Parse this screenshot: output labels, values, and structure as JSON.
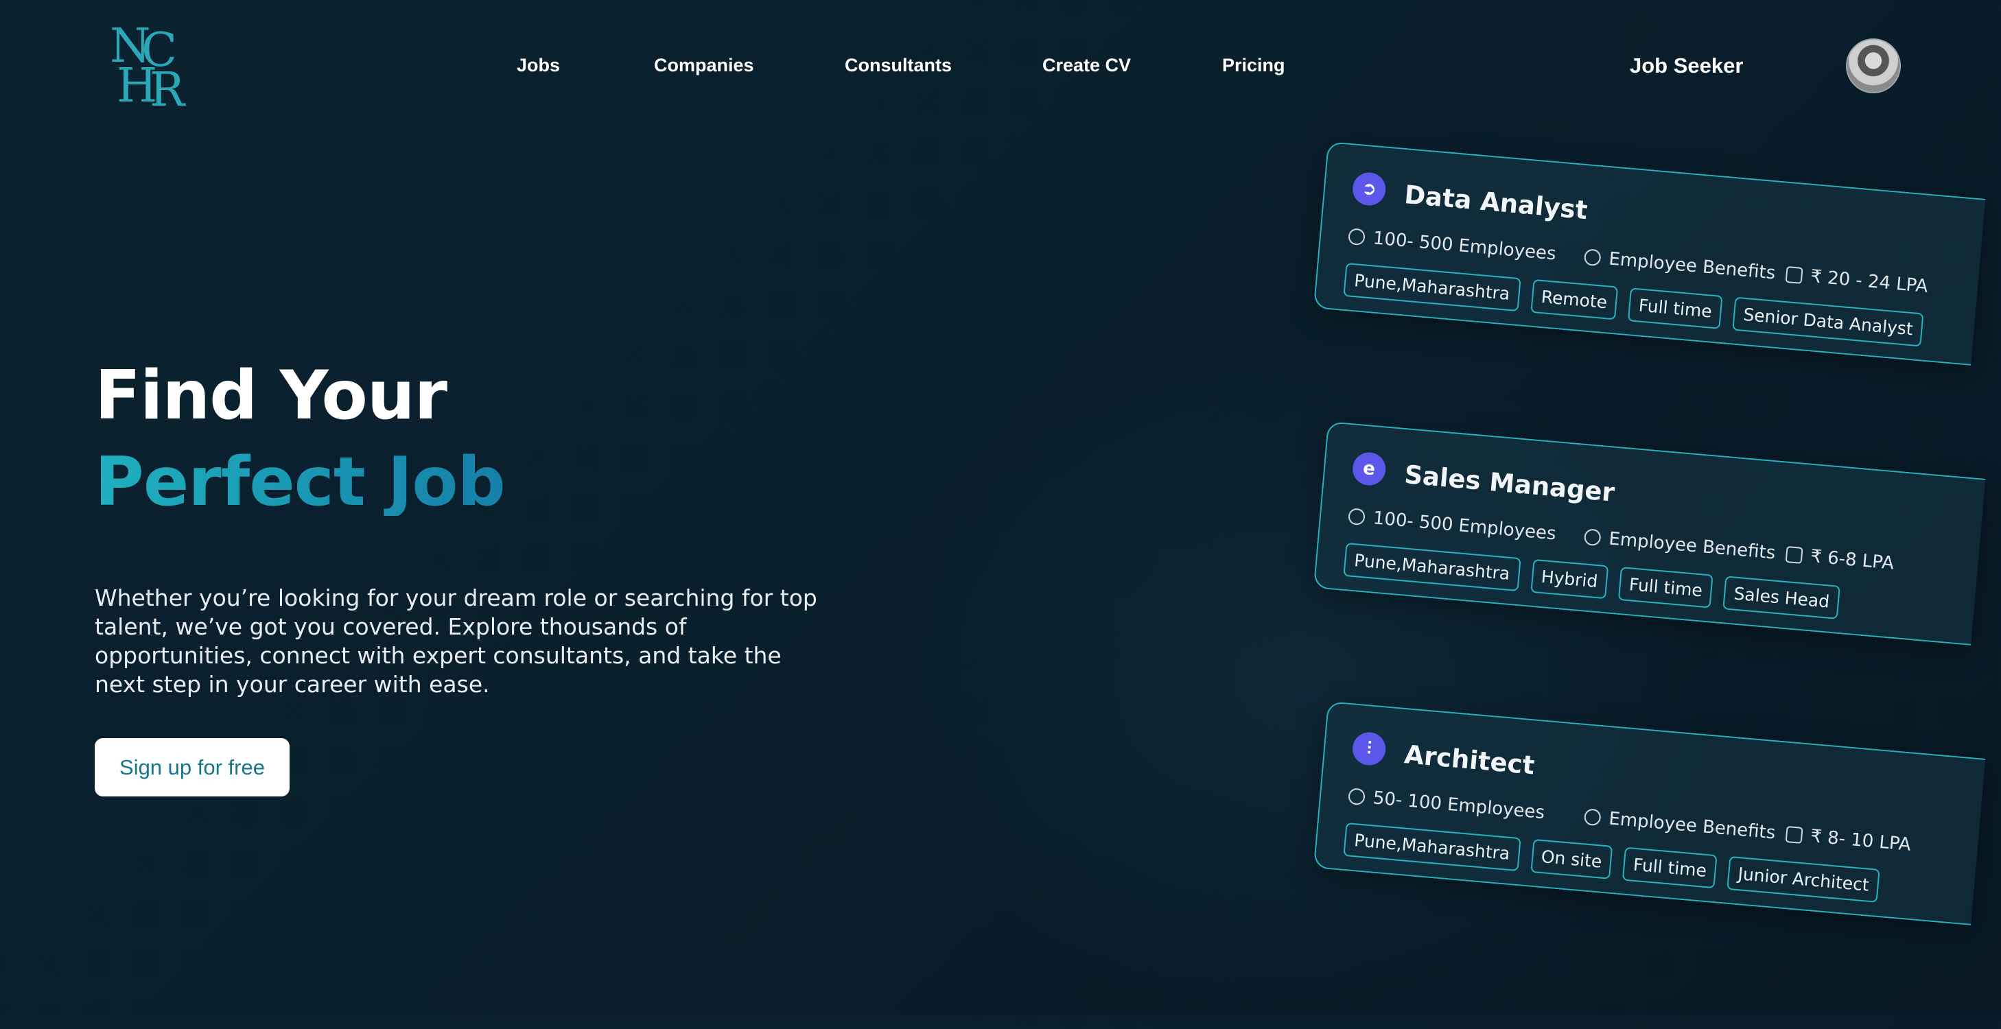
{
  "logo": {
    "letters": [
      "N",
      "C",
      "H",
      "R"
    ]
  },
  "nav": {
    "items": [
      "Jobs",
      "Companies",
      "Consultants",
      "Create CV",
      "Pricing"
    ]
  },
  "header": {
    "role_label": "Job Seeker"
  },
  "hero": {
    "title_line1": "Find Your",
    "title_line2": "Perfect Job",
    "description": "Whether you’re looking for your dream role or searching for top talent, we’ve got you covered. Explore thousands of opportunities, connect with expert consultants, and take the next step in your career with ease.",
    "cta_label": "Sign up for free"
  },
  "cards": [
    {
      "logo_glyph": "➲",
      "title": "Data Analyst",
      "employees": "100- 500 Employees",
      "benefits": "Employee Benefits",
      "salary": "₹ 20 - 24  LPA",
      "tags": [
        "Pune,Maharashtra",
        "Remote",
        "Full time",
        "Senior Data Analyst"
      ]
    },
    {
      "logo_glyph": "e",
      "title": "Sales Manager",
      "employees": "100- 500 Employees",
      "benefits": "Employee Benefits",
      "salary": "₹ 6-8 LPA",
      "tags": [
        "Pune,Maharashtra",
        "Hybrid",
        "Full time",
        "Sales Head"
      ]
    },
    {
      "logo_glyph": "⫶",
      "title": "Architect",
      "employees": "50- 100 Employees",
      "benefits": "Employee Benefits",
      "salary": "₹ 8- 10  LPA",
      "tags": [
        "Pune,Maharashtra",
        "On site",
        "Full time",
        "Junior Architect"
      ]
    }
  ],
  "colors": {
    "accent": "#1ea3b8",
    "card_border": "#23b3c3",
    "logo_badge": "#5b57e8",
    "background": "#0a1f2c"
  }
}
